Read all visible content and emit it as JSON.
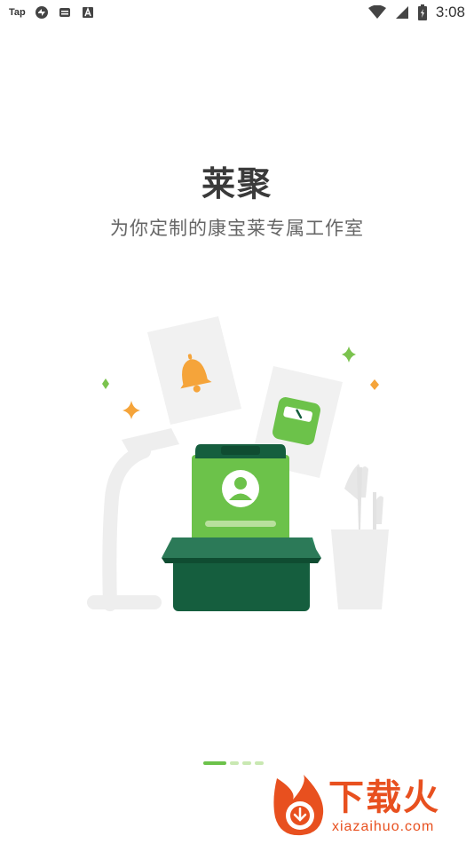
{
  "status_bar": {
    "app_label": "Tap",
    "time": "3:08",
    "icons": [
      "tap-app-icon",
      "vpn-icon",
      "message-icon",
      "a-icon",
      "wifi-icon",
      "signal-icon",
      "battery-icon"
    ]
  },
  "onboarding": {
    "title": "莱聚",
    "subtitle": "为你定制的康宝莱专属工作室",
    "current_page": 1,
    "page_count": 4
  },
  "illustration": {
    "items": [
      "bell-icon",
      "scale-icon",
      "clipboard-icon",
      "user-icon",
      "box-icon",
      "lamp-icon",
      "cup-icon",
      "brush-icon",
      "sparkle-icon"
    ],
    "colors": {
      "green": "#6cc24a",
      "dark_green": "#155e3e",
      "orange": "#f5a43a",
      "gray": "#eeeeee"
    }
  },
  "watermark": {
    "brand": "下载火",
    "url": "xiazaihuo.com",
    "color": "#e8501f"
  }
}
